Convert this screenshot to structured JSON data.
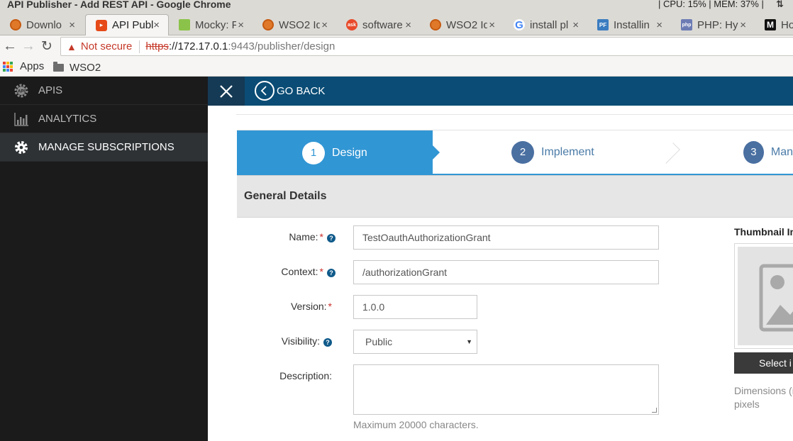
{
  "window": {
    "title": "API Publisher - Add REST API - Google Chrome",
    "system_status": "| CPU: 15% | MEM: 37% |"
  },
  "tabs": [
    {
      "label": "Downlo",
      "icon": "wso2-icon",
      "active": false
    },
    {
      "label": "API Publ",
      "icon": "api-publisher-icon",
      "active": true
    },
    {
      "label": "Mocky: F",
      "icon": "mocky-icon",
      "active": false
    },
    {
      "label": "WSO2 Id",
      "icon": "wso2-icon",
      "active": false
    },
    {
      "label": "software",
      "icon": "ask-icon",
      "active": false
    },
    {
      "label": "WSO2 Id",
      "icon": "wso2-icon",
      "active": false
    },
    {
      "label": "install pl",
      "icon": "google-icon",
      "active": false
    },
    {
      "label": "Installin",
      "icon": "pf-icon",
      "active": false
    },
    {
      "label": "PHP: Hyp",
      "icon": "php-icon",
      "active": false
    },
    {
      "label": "Ho",
      "icon": "medium-icon",
      "active": false
    }
  ],
  "address_bar": {
    "security_label": "Not secure",
    "url_scheme": "https",
    "url_host": "://172.17.0.1",
    "url_rest": ":9443/publisher/design"
  },
  "bookmarks": [
    {
      "label": "Apps",
      "icon": "apps-grid-icon"
    },
    {
      "label": "WSO2",
      "icon": "folder-icon"
    }
  ],
  "sidebar": {
    "items": [
      {
        "label": "APIS",
        "icon": "api-gear-icon",
        "active": false
      },
      {
        "label": "ANALYTICS",
        "icon": "bar-chart-icon",
        "active": false
      },
      {
        "label": "MANAGE SUBSCRIPTIONS",
        "icon": "gear-icon",
        "active": true
      }
    ]
  },
  "topbar": {
    "go_back_label": "GO BACK"
  },
  "wizard": {
    "steps": [
      {
        "number": "1",
        "label": "Design",
        "active": true
      },
      {
        "number": "2",
        "label": "Implement",
        "active": false
      },
      {
        "number": "3",
        "label": "Man",
        "active": false
      }
    ]
  },
  "form": {
    "section_title": "General Details",
    "name_label": "Name:",
    "name_value": "TestOauthAuthorizationGrant",
    "context_label": "Context:",
    "context_value": "/authorizationGrant",
    "version_label": "Version:",
    "version_value": "1.0.0",
    "visibility_label": "Visibility:",
    "visibility_value": "Public",
    "description_label": "Description:",
    "description_value": "",
    "description_hint": "Maximum 20000 characters.",
    "required_marker": "*",
    "help_marker": "?"
  },
  "thumbnail": {
    "title": "Thumbnail Im",
    "button_label": "Select i",
    "hint_line1": "Dimensions (n",
    "hint_line2": "pixels"
  },
  "colors": {
    "topbar": "#0a4c75",
    "wizard_active": "#3196d4",
    "sidebar": "#1b1b1b",
    "required": "#c9302c"
  }
}
